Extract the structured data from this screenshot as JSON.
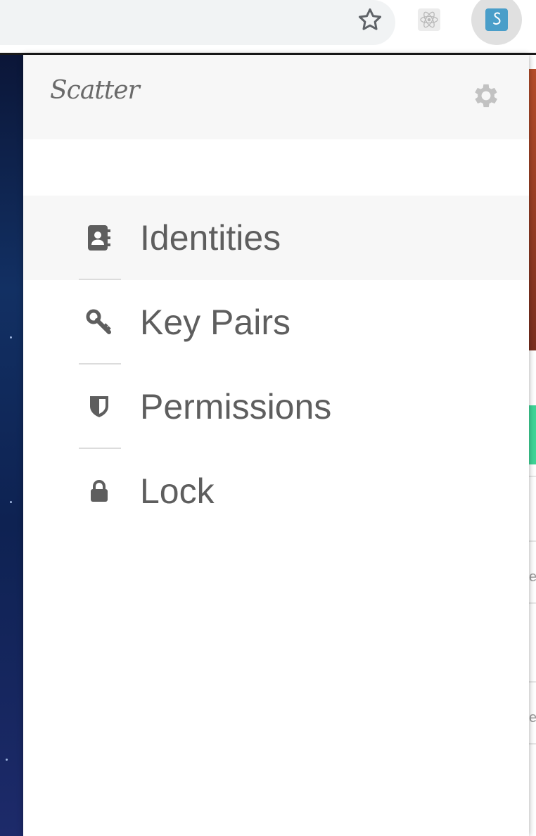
{
  "browser": {
    "bookmark_icon": "star-outline-icon",
    "extensions": [
      {
        "name": "React Developer Tools",
        "icon": "react-atom-icon"
      },
      {
        "name": "Scatter",
        "icon": "scatter-s-icon",
        "active": true
      }
    ]
  },
  "popup": {
    "logo_text": "Scatter",
    "settings_icon": "gear-icon",
    "menu": [
      {
        "label": "Identities",
        "icon": "address-book-icon",
        "active": true
      },
      {
        "label": "Key Pairs",
        "icon": "key-icon",
        "active": false
      },
      {
        "label": "Permissions",
        "icon": "shield-icon",
        "active": false
      },
      {
        "label": "Lock",
        "icon": "lock-icon",
        "active": false
      }
    ]
  },
  "background_page": {
    "visible_letters": [
      "e",
      "e"
    ]
  },
  "colors": {
    "menu_text": "#5e5e5e",
    "header_bg": "#f7f7f7",
    "scatter_brand": "#4a9ec9",
    "accent_green": "#3fd497"
  }
}
